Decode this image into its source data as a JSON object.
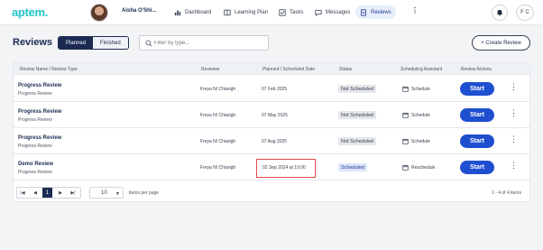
{
  "app": {
    "logo": "aptem.",
    "user_name": "Aisha O'Shi...",
    "user_initials": "F C"
  },
  "nav": [
    {
      "label": "Dashboard",
      "icon": "bar-chart-icon"
    },
    {
      "label": "Learning Plan",
      "icon": "book-icon"
    },
    {
      "label": "Tasks",
      "icon": "checklist-icon"
    },
    {
      "label": "Messages",
      "icon": "chat-icon"
    },
    {
      "label": "Reviews",
      "icon": "reviews-icon",
      "active": true
    }
  ],
  "page": {
    "title": "Reviews"
  },
  "tabs": {
    "planned": "Planned",
    "finished": "Finished",
    "selected": "Planned"
  },
  "filter": {
    "placeholder": "Filter by type..."
  },
  "create_button": "+ Create Review",
  "table": {
    "headers": {
      "name": "Review Name / Review Type",
      "reviewer": "Reviewer",
      "date": "Planned / Scheduled Date",
      "status": "Status",
      "assistant": "Scheduling Assistant",
      "actions": "Review Actions"
    },
    "rows": [
      {
        "title": "Progress Review",
        "type": "Progress Review",
        "reviewer": "Freya Ní Chiarigh",
        "date": "07 Feb 2025",
        "status": "Not Scheduled",
        "assistant": "Schedule",
        "action": "Start"
      },
      {
        "title": "Progress Review",
        "type": "Progress Review",
        "reviewer": "Freya Ní Chiarigh",
        "date": "07 May 2025",
        "status": "Not Scheduled",
        "assistant": "Schedule",
        "action": "Start"
      },
      {
        "title": "Progress Review",
        "type": "Progress Review",
        "reviewer": "Freya Ní Chiarigh",
        "date": "07 Aug 2025",
        "status": "Not Scheduled",
        "assistant": "Schedule",
        "action": "Start"
      },
      {
        "title": "Demo Review",
        "type": "Progress Review",
        "reviewer": "Freya Ní Chiarigh",
        "date": "02 Sep 2024 at 10:00",
        "status": "Scheduled",
        "assistant": "Reschedule",
        "action": "Start"
      }
    ]
  },
  "pagination": {
    "current_page": "1",
    "per_page": "10",
    "per_page_label": "items per page",
    "range": "1 - 4 of 4 items"
  },
  "colors": {
    "accent": "#1f4fd1",
    "navy": "#1c2a52",
    "logo": "#21c4c8",
    "highlight": "#e24b4b"
  }
}
